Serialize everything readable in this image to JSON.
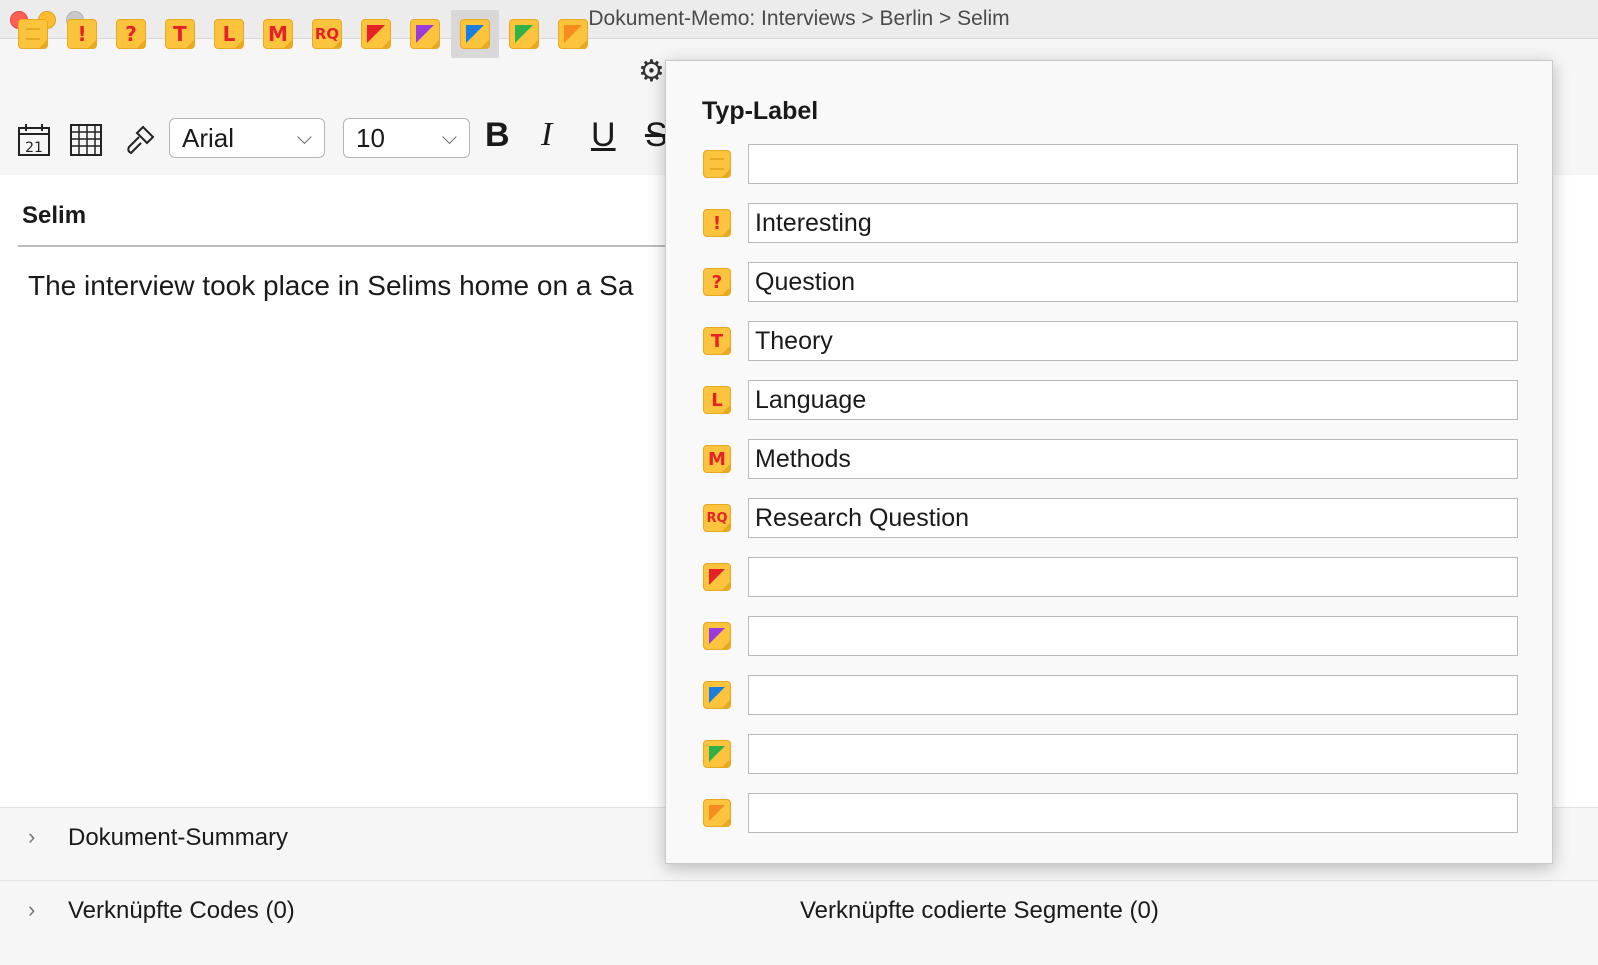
{
  "window": {
    "title": "Dokument-Memo: Interviews > Berlin > Selim"
  },
  "toolbar": {
    "memo_types": [
      {
        "icon": "memo-lines-icon",
        "glyph": ""
      },
      {
        "icon": "memo-exclamation-icon",
        "glyph": "!"
      },
      {
        "icon": "memo-question-icon",
        "glyph": "?"
      },
      {
        "icon": "memo-t-icon",
        "glyph": "T"
      },
      {
        "icon": "memo-l-icon",
        "glyph": "L"
      },
      {
        "icon": "memo-m-icon",
        "glyph": "M"
      },
      {
        "icon": "memo-rq-icon",
        "glyph": "RQ"
      },
      {
        "icon": "memo-red-icon",
        "color": "#e5222a"
      },
      {
        "icon": "memo-purple-icon",
        "color": "#9b3bdc"
      },
      {
        "icon": "memo-blue-icon",
        "color": "#1a7de0"
      },
      {
        "icon": "memo-green-icon",
        "color": "#2fb24a"
      },
      {
        "icon": "memo-orange-icon",
        "color": "#f68b1f"
      }
    ],
    "font": "Arial",
    "font_size": "10",
    "bold": "B",
    "italic": "I",
    "underline": "U",
    "strike": "S",
    "calendar_day": "21"
  },
  "document": {
    "title": "Selim",
    "text": "The interview took place in Selims home on a Sa"
  },
  "panels": {
    "summary": "Dokument-Summary",
    "linked_codes": "Verknüpfte Codes (0)",
    "linked_segments": "Verknüpfte codierte Segmente (0)"
  },
  "popover": {
    "title": "Typ-Label",
    "rows": [
      {
        "icon": "memo-lines-icon",
        "value": ""
      },
      {
        "icon": "memo-exclamation-icon",
        "value": "Interesting"
      },
      {
        "icon": "memo-question-icon",
        "value": "Question"
      },
      {
        "icon": "memo-t-icon",
        "value": "Theory"
      },
      {
        "icon": "memo-l-icon",
        "value": "Language"
      },
      {
        "icon": "memo-m-icon",
        "value": "Methods"
      },
      {
        "icon": "memo-rq-icon",
        "value": "Research Question"
      },
      {
        "icon": "memo-red-icon",
        "value": ""
      },
      {
        "icon": "memo-purple-icon",
        "value": ""
      },
      {
        "icon": "memo-blue-icon",
        "value": ""
      },
      {
        "icon": "memo-green-icon",
        "value": ""
      },
      {
        "icon": "memo-orange-icon",
        "value": ""
      }
    ]
  },
  "colors": {
    "memo_yellow": "#fcc43d",
    "memo_letter": "#e5222a"
  }
}
